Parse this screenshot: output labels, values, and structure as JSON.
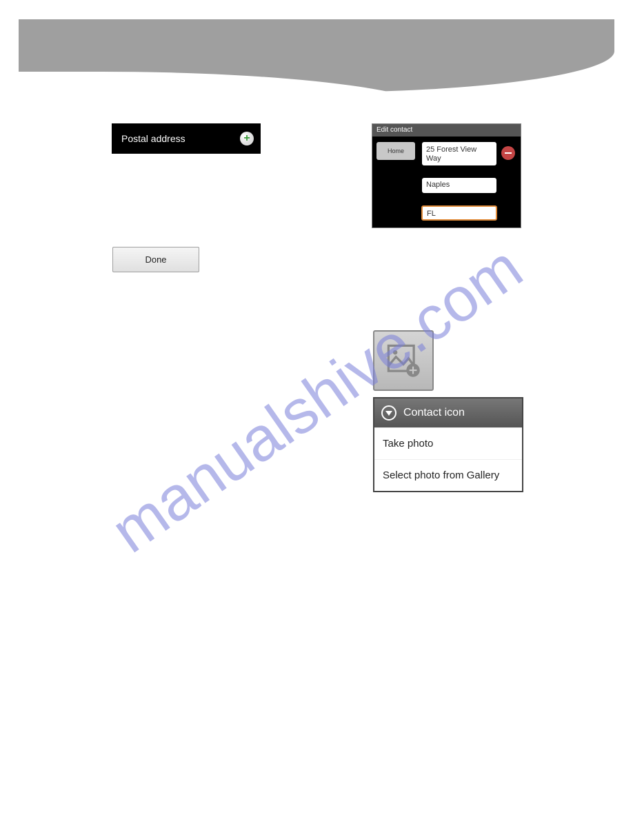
{
  "watermark": "manualshive.com",
  "postal": {
    "label": "Postal address"
  },
  "done": {
    "label": "Done"
  },
  "edit_contact": {
    "title": "Edit contact",
    "type_label": "Home",
    "address_line": "25 Forest View Way",
    "city": "Naples",
    "state": "FL"
  },
  "contact_icon_menu": {
    "title": "Contact icon",
    "option1": "Take photo",
    "option2": "Select photo from Gallery"
  }
}
